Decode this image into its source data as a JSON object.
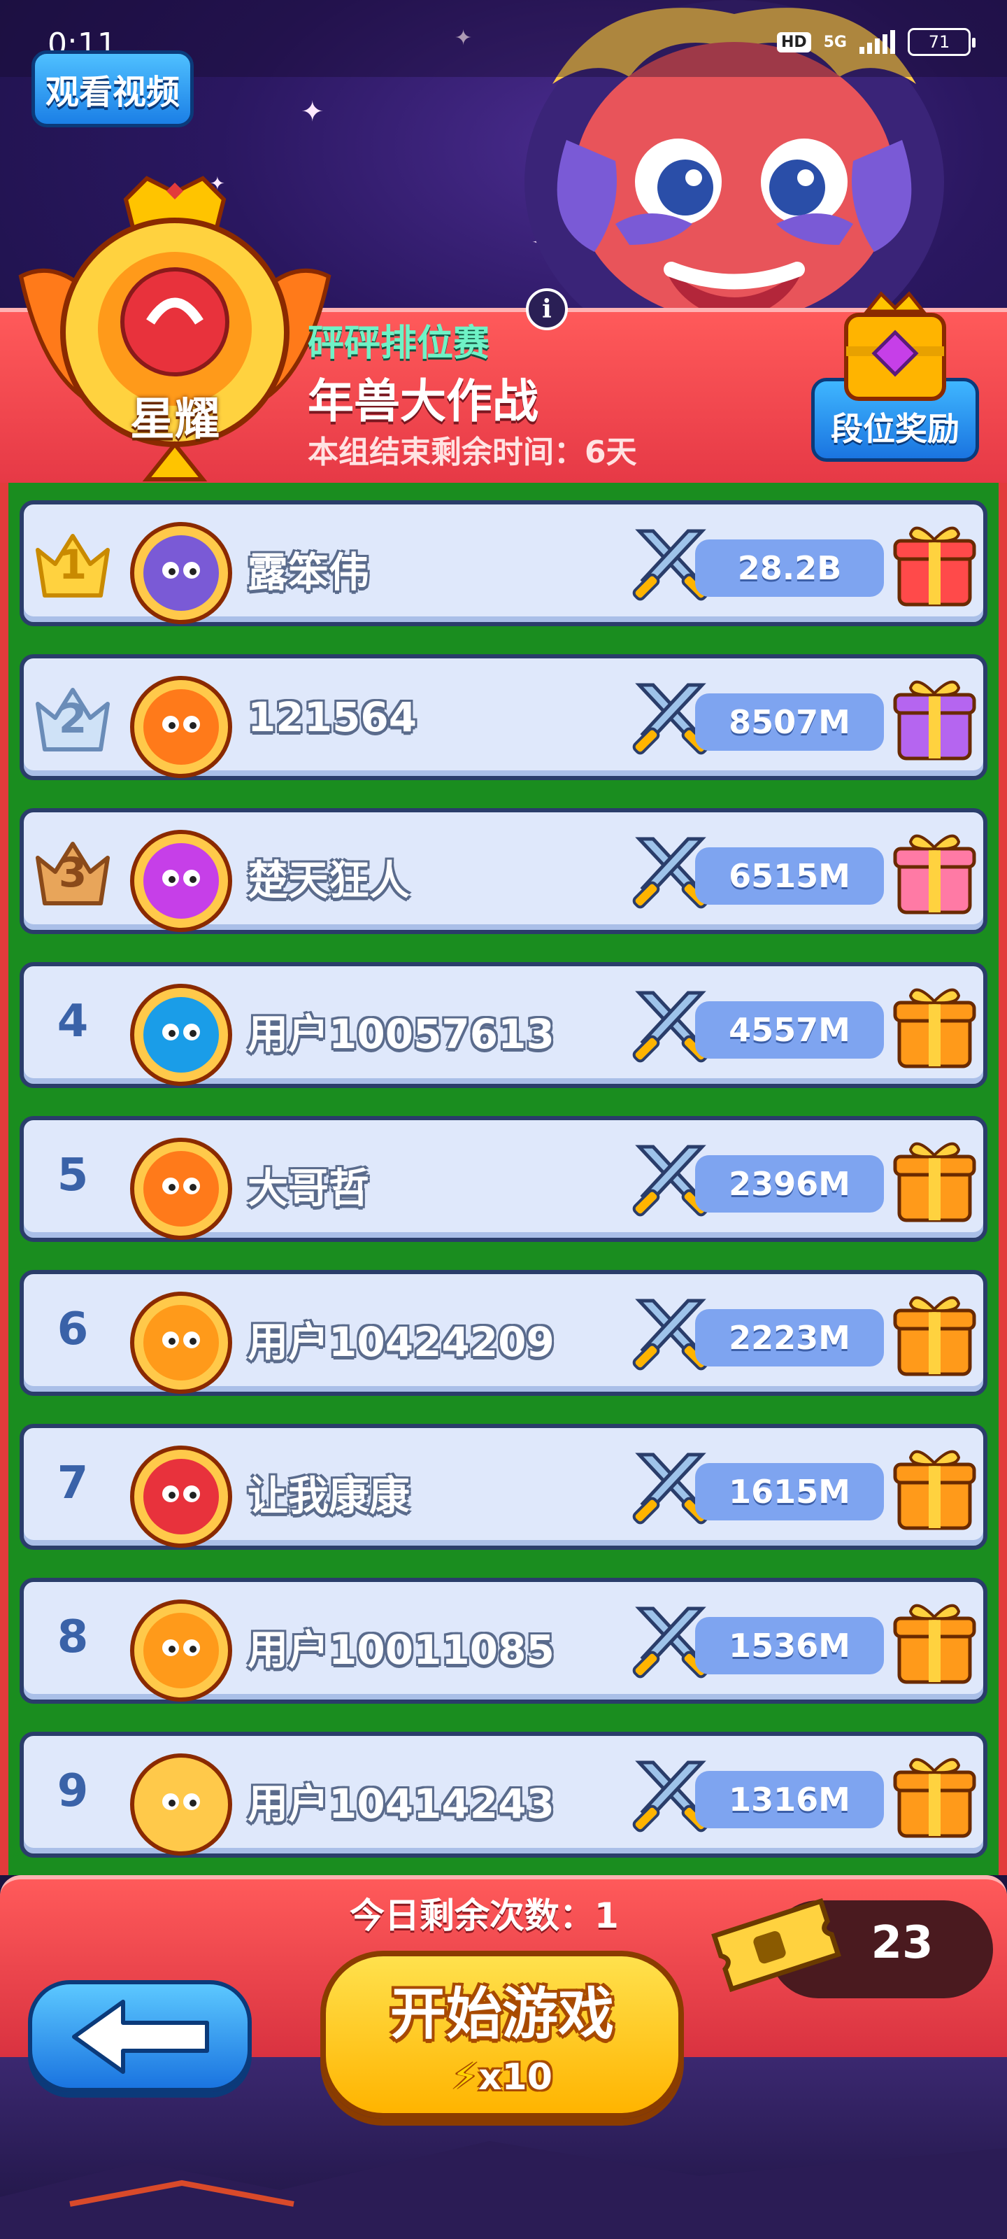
{
  "status_bar": {
    "time": "0:11",
    "hd": "HD",
    "network": "5G",
    "battery": "71"
  },
  "header": {
    "video_button": "观看视频",
    "rank_tier": "星耀",
    "event_subtitle": "砰砰排位赛",
    "event_title": "年兽大作战",
    "time_left": "本组结束剩余时间：6天",
    "info_icon": "i",
    "reward_button": "段位奖励"
  },
  "leaderboard": [
    {
      "rank": "1",
      "name": "露笨伟",
      "score": "28.2B",
      "medal": "gold",
      "gift": "red"
    },
    {
      "rank": "2",
      "name": "121564",
      "score": "8507M",
      "medal": "silver",
      "gift": "purple"
    },
    {
      "rank": "3",
      "name": "楚天狂人",
      "score": "6515M",
      "medal": "bronze",
      "gift": "pink"
    },
    {
      "rank": "4",
      "name": "用户10057613",
      "score": "4557M",
      "medal": "none",
      "gift": "orange"
    },
    {
      "rank": "5",
      "name": "大哥哲",
      "score": "2396M",
      "medal": "none",
      "gift": "orange"
    },
    {
      "rank": "6",
      "name": "用户10424209",
      "score": "2223M",
      "medal": "none",
      "gift": "orange"
    },
    {
      "rank": "7",
      "name": "让我康康",
      "score": "1615M",
      "medal": "none",
      "gift": "orange"
    },
    {
      "rank": "8",
      "name": "用户10011085",
      "score": "1536M",
      "medal": "none",
      "gift": "orange"
    },
    {
      "rank": "9",
      "name": "用户10414243",
      "score": "1316M",
      "medal": "none",
      "gift": "orange"
    }
  ],
  "footer": {
    "remaining_today": "今日剩余次数：1",
    "ticket_count": "23",
    "start_button": "开始游戏",
    "start_cost": "x10"
  },
  "colors": {
    "header_red": "#e63946",
    "list_green": "#1a8d1f",
    "row_bg": "#dfe8fb",
    "score_pill": "#7ea4f0",
    "start_yellow": "#ffc400",
    "back_blue": "#1a74e0"
  }
}
